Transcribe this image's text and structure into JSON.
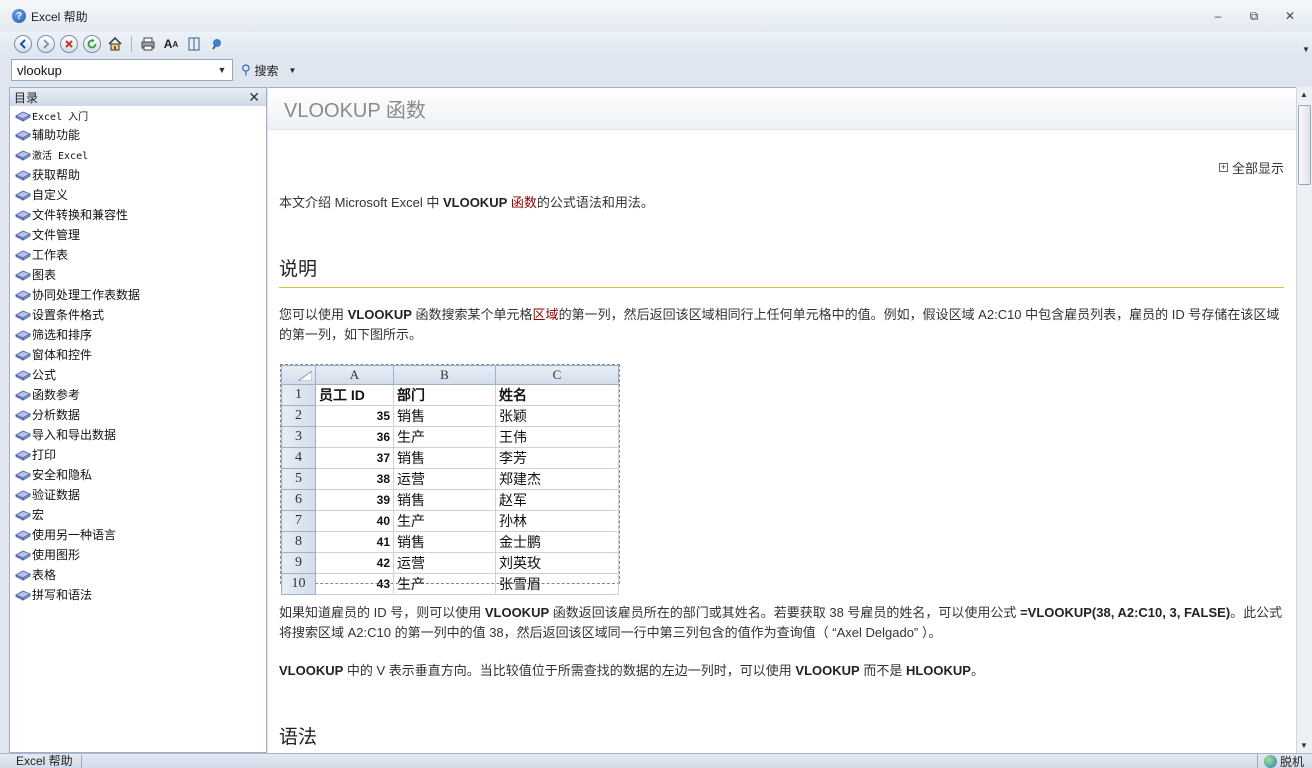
{
  "window": {
    "title": "Excel 帮助",
    "minimize_glyph": "–",
    "restore_glyph": "⧉",
    "close_glyph": "✕"
  },
  "toolbar": {
    "buttons": [
      "back-icon",
      "forward-icon",
      "stop-icon",
      "refresh-icon",
      "home-icon",
      "print-icon",
      "font-size-icon",
      "toc-book-icon",
      "pin-icon"
    ]
  },
  "search": {
    "query": "vlookup",
    "button_label": "搜索"
  },
  "toc": {
    "header": "目录",
    "items": [
      "Excel 入门",
      "辅助功能",
      "激活 Excel",
      "获取帮助",
      "自定义",
      "文件转换和兼容性",
      "文件管理",
      "工作表",
      "图表",
      "协同处理工作表数据",
      "设置条件格式",
      "筛选和排序",
      "窗体和控件",
      "公式",
      "函数参考",
      "分析数据",
      "导入和导出数据",
      "打印",
      "安全和隐私",
      "验证数据",
      "宏",
      "使用另一种语言",
      "使用图形",
      "表格",
      "拼写和语法"
    ]
  },
  "content": {
    "title": "VLOOKUP 函数",
    "show_all": "全部显示",
    "intro": {
      "before": "本文介绍 Microsoft Excel 中 ",
      "bold": "VLOOKUP",
      "link": "函数",
      "after": "的公式语法和用法。"
    },
    "section_description": "说明",
    "desc": {
      "before": "您可以使用 ",
      "bold": "VLOOKUP",
      "mid": " 函数搜索某个单元格",
      "link": "区域",
      "after": "的第一列，然后返回该区域相同行上任何单元格中的值。例如，假设区域 A2:C10 中包含雇员列表，雇员的 ID 号存储在该区域的第一列，如下图所示。"
    },
    "para2": {
      "a": "如果知道雇员的 ID 号，则可以使用 ",
      "b": "VLOOKUP",
      "c": " 函数返回该雇员所在的部门或其姓名。若要获取 38 号雇员的姓名，可以使用公式 ",
      "d": "=VLOOKUP(38, A2:C10, 3, FALSE)",
      "e": "。此公式将搜索区域 A2:C10 的第一列中的值 38，然后返回该区域同一行中第三列包含的值作为查询值（ “Axel Delgado” ）。"
    },
    "para3": {
      "a": "VLOOKUP",
      "b": " 中的 V 表示垂直方向。当比较值位于所需查找的数据的左边一列时，可以使用 ",
      "c": "VLOOKUP",
      "d": " 而不是 ",
      "e": "HLOOKUP",
      "f": "。"
    },
    "section_syntax": "语法"
  },
  "sheet": {
    "columns": [
      "A",
      "B",
      "C"
    ],
    "rows": [
      {
        "n": "1",
        "a": "员工 ID",
        "b": "部门",
        "c": "姓名"
      },
      {
        "n": "2",
        "a": "35",
        "b": "销售",
        "c": "张颖"
      },
      {
        "n": "3",
        "a": "36",
        "b": "生产",
        "c": "王伟"
      },
      {
        "n": "4",
        "a": "37",
        "b": "销售",
        "c": "李芳"
      },
      {
        "n": "5",
        "a": "38",
        "b": "运营",
        "c": "郑建杰"
      },
      {
        "n": "6",
        "a": "39",
        "b": "销售",
        "c": "赵军"
      },
      {
        "n": "7",
        "a": "40",
        "b": "生产",
        "c": "孙林"
      },
      {
        "n": "8",
        "a": "41",
        "b": "销售",
        "c": "金士鹏"
      },
      {
        "n": "9",
        "a": "42",
        "b": "运营",
        "c": "刘英玫"
      },
      {
        "n": "10",
        "a": "43",
        "b": "生产",
        "c": "张雪眉"
      }
    ]
  },
  "status": {
    "left": "Excel 帮助",
    "right": "脱机"
  },
  "colors": {
    "link": "#8b0000",
    "rule": "#d8c23a",
    "accent": "#2a5ea9"
  }
}
